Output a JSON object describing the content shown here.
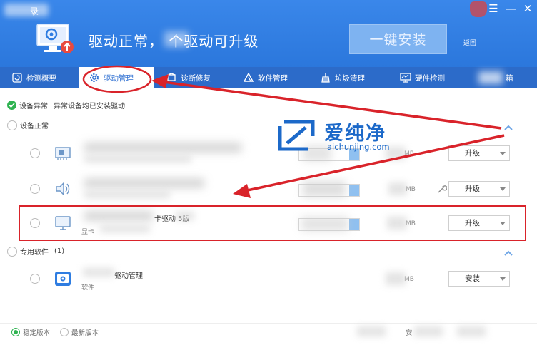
{
  "window": {
    "title": "录",
    "controls": [
      "☰",
      "—",
      "✕"
    ]
  },
  "header": {
    "status_text": "驱动正常，  个驱动可升级",
    "install_button": "一键安装",
    "back_link": "返回"
  },
  "tabs": [
    {
      "label": "检测概要",
      "icon": "refresh-icon",
      "active": false
    },
    {
      "label": "驱动管理",
      "icon": "gear-icon",
      "active": true
    },
    {
      "label": "诊断修复",
      "icon": "repair-icon",
      "active": false
    },
    {
      "label": "软件管理",
      "icon": "software-icon",
      "active": false
    },
    {
      "label": "垃圾清理",
      "icon": "broom-icon",
      "active": false
    },
    {
      "label": "硬件检测",
      "icon": "monitor-icon",
      "active": false
    },
    {
      "label": "箱",
      "icon": "toolbox-icon",
      "active": false
    }
  ],
  "summary": {
    "abnormal_label": "设备异常",
    "abnormal_desc": "异常设备均已安装驱动"
  },
  "groups": [
    {
      "title": "设备正常",
      "items": [
        {
          "icon": "network-card-icon",
          "name": "I",
          "sub": "",
          "size": "MB",
          "action": "升级"
        },
        {
          "icon": "speaker-icon",
          "name": "",
          "sub": "",
          "size": "MB",
          "action": "升级"
        },
        {
          "icon": "display-icon",
          "name": "卡驱动    5版",
          "sub": "显卡",
          "size": "MB",
          "action": "升级"
        }
      ]
    },
    {
      "title": "专用软件",
      "count": "(1)",
      "items": [
        {
          "icon": "camera-software-icon",
          "name": "驱动管理",
          "sub": "软件",
          "size": "MB",
          "action": "安装"
        }
      ]
    }
  ],
  "footer": {
    "stable_label": "稳定版本",
    "latest_label": "最新版本",
    "right_text": "安"
  },
  "watermark": {
    "brand": "爱纯净",
    "url": "aichunjing.com"
  },
  "colors": {
    "header_blue": "#2f7de1",
    "tab_bar": "#2c6bc9",
    "accent_green": "#2fb351",
    "annotation_red": "#d9232a"
  }
}
